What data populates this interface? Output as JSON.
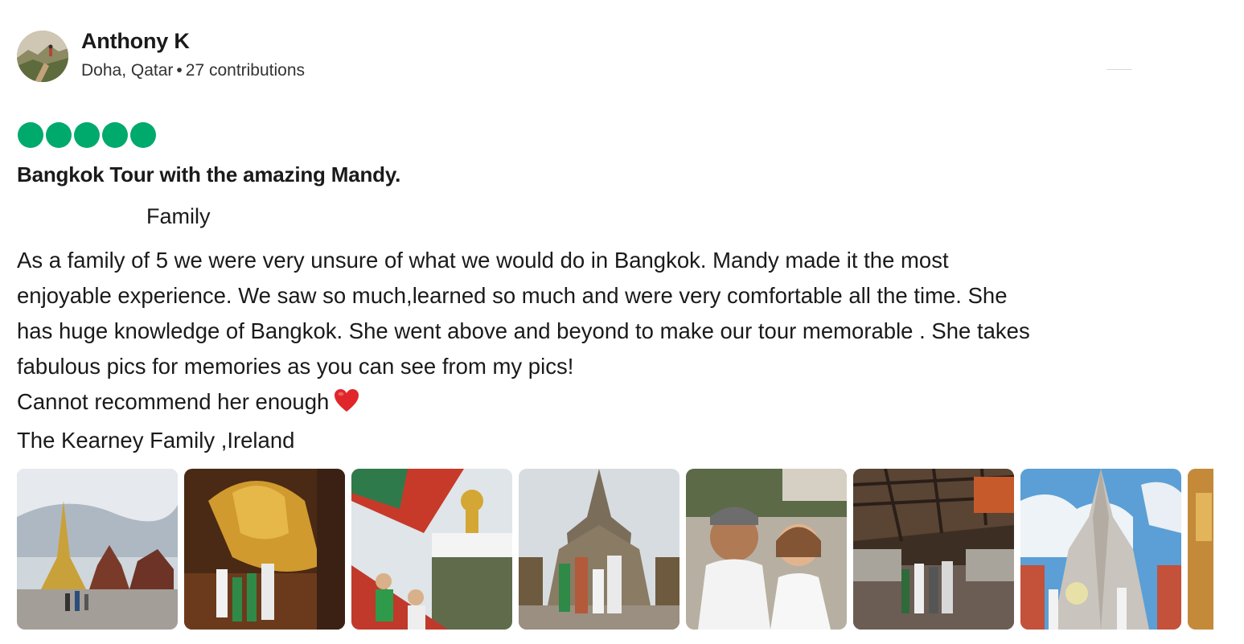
{
  "reviewer": {
    "name": "Anthony K",
    "location": "Doha, Qatar",
    "separator": "•",
    "contributions": "27 contributions",
    "avatar_icon": "mountain-hiker-avatar"
  },
  "rating": {
    "value": 5,
    "max": 5,
    "color": "#00aa6c"
  },
  "review": {
    "title": "Bangkok Tour with the amazing Mandy.",
    "trip_type": "Family",
    "body_lines": [
      "As a family of 5 we were very unsure of what we would do in Bangkok. Mandy made it the most",
      "enjoyable experience. We saw so much,learned so much and were very comfortable all the time. She",
      "has huge knowledge of Bangkok. She went above and beyond to make our tour memorable . She takes",
      "fabulous pics for memories as you can see from my pics!",
      "Cannot recommend her enough",
      "The Kearney Family ,Ireland"
    ],
    "heart_icon": "red-heart-emoji"
  },
  "photos": [
    {
      "name": "photo-grand-palace"
    },
    {
      "name": "photo-reclining-buddha"
    },
    {
      "name": "photo-longtail-boat"
    },
    {
      "name": "photo-temple-family"
    },
    {
      "name": "photo-guide-selfie"
    },
    {
      "name": "photo-market"
    },
    {
      "name": "photo-wat-arun"
    },
    {
      "name": "photo-partial"
    }
  ]
}
